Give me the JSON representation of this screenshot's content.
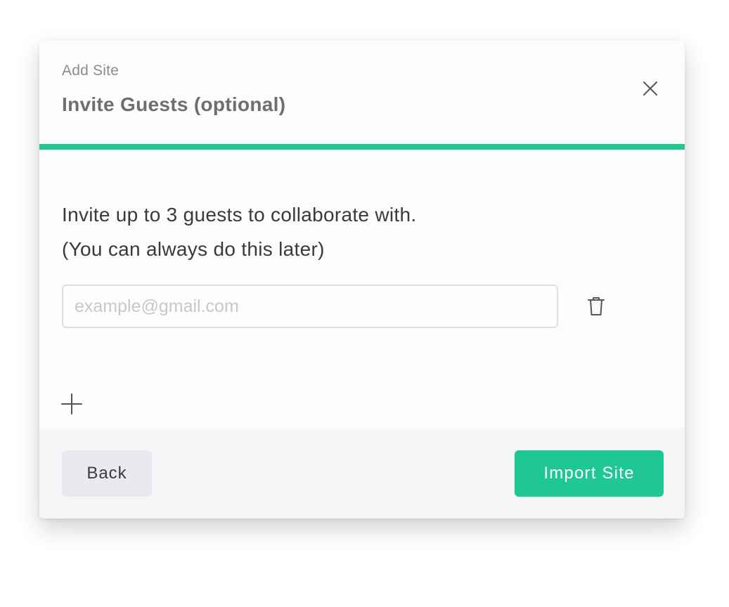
{
  "dialog": {
    "step_label": "Add Site",
    "title": "Invite Guests (optional)",
    "close_icon": "close-icon",
    "progress": 1.0,
    "progress_color": "#1fc793"
  },
  "body": {
    "intro_line1": "Invite up to 3 guests to collaborate with.",
    "intro_line2": "(You can always do this later)",
    "email_input": {
      "value": "",
      "placeholder": "example@gmail.com"
    },
    "delete_icon": "trash-icon",
    "add_icon": "plus-icon"
  },
  "footer": {
    "back_label": "Back",
    "import_label": "Import Site",
    "accent_color": "#1fc793"
  }
}
